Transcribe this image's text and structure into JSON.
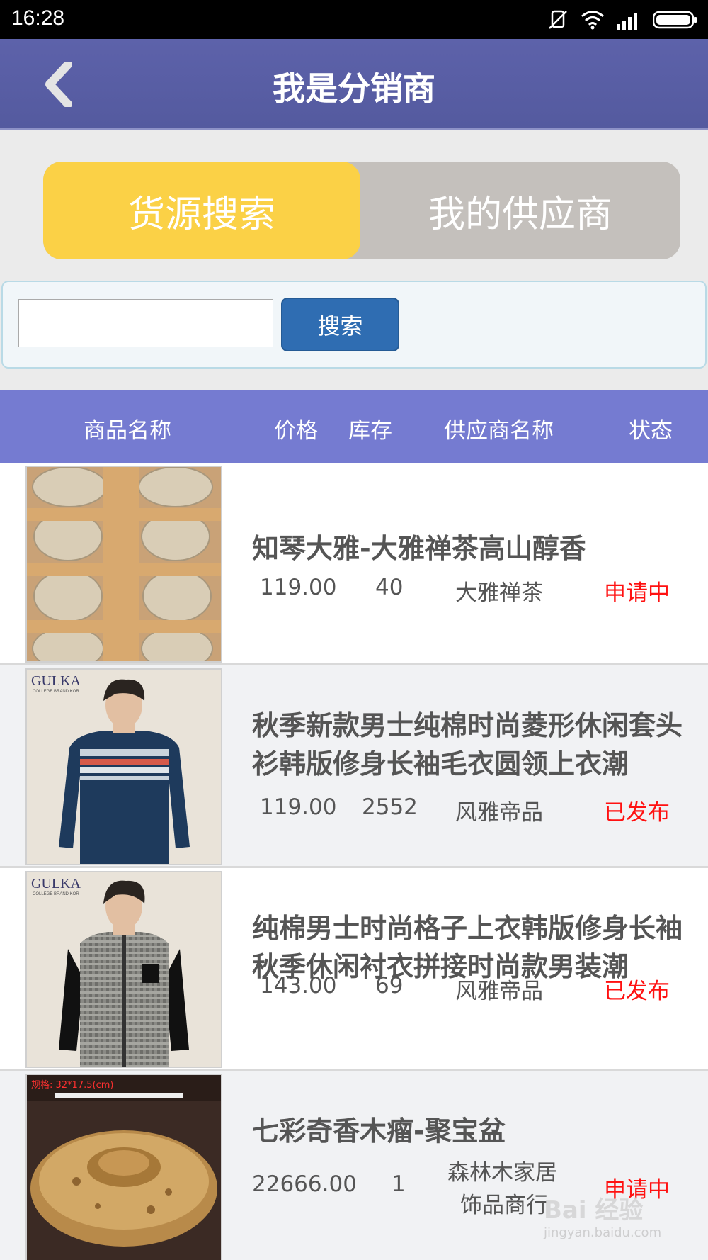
{
  "status_bar": {
    "time": "16:28",
    "icons": [
      "mute-icon",
      "wifi-icon",
      "signal-icon",
      "battery-icon"
    ]
  },
  "app_bar": {
    "title": "我是分销商",
    "back_icon": "chevron-left-icon"
  },
  "tabs": [
    {
      "label": "货源搜索",
      "active": true
    },
    {
      "label": "我的供应商",
      "active": false
    }
  ],
  "search": {
    "value": "",
    "placeholder": "",
    "button_label": "搜索"
  },
  "table": {
    "columns": [
      "商品名称",
      "价格",
      "库存",
      "供应商名称",
      "状态"
    ],
    "rows": [
      {
        "name": "知琴大雅-大雅禅茶高山醇香",
        "price": "119.00",
        "stock": "40",
        "supplier": "大雅禅茶",
        "supplier_line2": "",
        "status": "申请中",
        "thumb": "tea-cakes-photo"
      },
      {
        "name": "秋季新款男士纯棉时尚菱形休闲套头衫韩版修身长袖毛衣圆领上衣潮",
        "price": "119.00",
        "stock": "2552",
        "supplier": "风雅帝品",
        "supplier_line2": "",
        "status": "已发布",
        "thumb": "navy-sweater-photo"
      },
      {
        "name": "纯棉男士时尚格子上衣韩版修身长袖秋季休闲衬衣拼接时尚款男装潮",
        "price": "143.00",
        "stock": "69",
        "supplier": "风雅帝品",
        "supplier_line2": "",
        "status": "已发布",
        "thumb": "plaid-shirt-photo"
      },
      {
        "name": "七彩奇香木瘤-聚宝盆",
        "price": "22666.00",
        "stock": "1",
        "supplier": "森林木家居",
        "supplier_line2": "饰品商行",
        "status": "申请中",
        "thumb": "wooden-bowl-photo"
      }
    ]
  },
  "thumb_labels": {
    "brand": "GULKA",
    "brand_sub": "COLLEGE BRAND KOR",
    "wood_caption": "规格: 32*17.5(cm)"
  },
  "watermark": {
    "text": "Bai 经验",
    "url": "jingyan.baidu.com"
  }
}
